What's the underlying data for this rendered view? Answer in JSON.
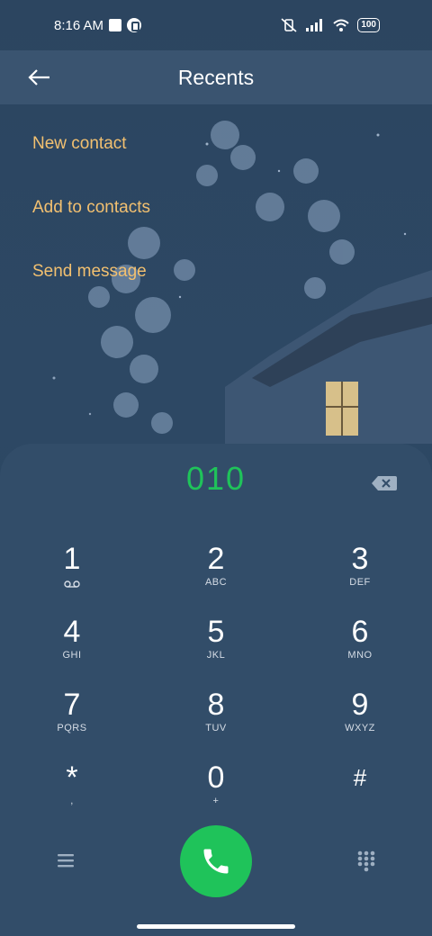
{
  "status": {
    "time": "8:16 AM",
    "battery": "100"
  },
  "header": {
    "title": "Recents"
  },
  "actions": [
    {
      "label": "New contact"
    },
    {
      "label": "Add to contacts"
    },
    {
      "label": "Send message"
    }
  ],
  "dialpad": {
    "number": "010",
    "keys": [
      {
        "digit": "1",
        "letters": ""
      },
      {
        "digit": "2",
        "letters": "ABC"
      },
      {
        "digit": "3",
        "letters": "DEF"
      },
      {
        "digit": "4",
        "letters": "GHI"
      },
      {
        "digit": "5",
        "letters": "JKL"
      },
      {
        "digit": "6",
        "letters": "MNO"
      },
      {
        "digit": "7",
        "letters": "PQRS"
      },
      {
        "digit": "8",
        "letters": "TUV"
      },
      {
        "digit": "9",
        "letters": "WXYZ"
      },
      {
        "digit": "*",
        "letters": ","
      },
      {
        "digit": "0",
        "letters": "+"
      },
      {
        "digit": "#",
        "letters": ""
      }
    ]
  },
  "icons": {
    "back": "back-arrow-icon",
    "backspace": "backspace-icon",
    "voicemail": "voicemail-icon",
    "menu": "menu-icon",
    "call": "phone-icon",
    "keypad": "keypad-icon"
  },
  "colors": {
    "accent_green": "#1fc35a",
    "action_text": "#f2c070",
    "panel": "#324d69",
    "header": "#3a5470"
  }
}
